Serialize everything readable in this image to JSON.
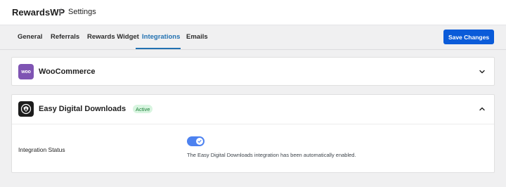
{
  "header": {
    "brand": "RewardsWP",
    "separator": "/",
    "page": "Settings"
  },
  "tabs": [
    {
      "label": "General",
      "active": false
    },
    {
      "label": "Referrals",
      "active": false
    },
    {
      "label": "Rewards Widget",
      "active": false
    },
    {
      "label": "Integrations",
      "active": true
    },
    {
      "label": "Emails",
      "active": false
    }
  ],
  "toolbar": {
    "save_label": "Save Changes"
  },
  "integrations": [
    {
      "name": "WooCommerce",
      "logo_text": "woo",
      "logo_color": "#7f54b3",
      "expanded": false
    },
    {
      "name": "Easy Digital Downloads",
      "badge": "Active",
      "logo_color": "#1c1c1c",
      "expanded": true,
      "status_label": "Integration Status",
      "toggle_on": true,
      "status_description": "The Easy Digital Downloads integration has been automatically enabled."
    }
  ],
  "colors": {
    "accent": "#2271b1",
    "button": "#0a5bd9",
    "toggle": "#4d82f0",
    "badge_bg": "#d8f5e0",
    "badge_text": "#1a7f37"
  },
  "icons": {
    "collapsed": "chevron-down-icon",
    "expanded": "chevron-up-icon",
    "toggle_on": "check-icon"
  }
}
